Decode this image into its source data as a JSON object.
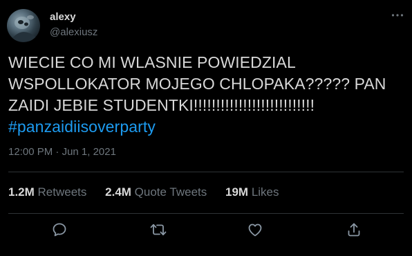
{
  "author": {
    "display_name": "alexy",
    "handle": "@alexiusz",
    "avatar_icon": "avatar-image"
  },
  "tweet": {
    "text_lines": [
      "WIECIE CO MI WLASNIE POWIEDZIAL",
      "WSPOLLOKATOR MOJEGO CHLOPAKA????? PAN",
      "ZAIDI JEBIE STUDENTKI!!!!!!!!!!!!!!!!!!!!!!!!!!!"
    ],
    "hashtag": "#panzaidiisoverparty"
  },
  "meta": {
    "time": "12:00 PM",
    "separator": " · ",
    "date": "Jun 1, 2021"
  },
  "stats": [
    {
      "count": "1.2M",
      "label": "Retweets"
    },
    {
      "count": "2.4M",
      "label": "Quote Tweets"
    },
    {
      "count": "19M",
      "label": "Likes"
    }
  ],
  "actions": {
    "reply_icon": "reply-icon",
    "retweet_icon": "retweet-icon",
    "like_icon": "heart-icon",
    "share_icon": "share-icon"
  },
  "colors": {
    "background": "#000000",
    "text": "#d9d9d9",
    "secondary": "#6e767d",
    "accent": "#1d9bf0",
    "divider": "#2f3336"
  }
}
